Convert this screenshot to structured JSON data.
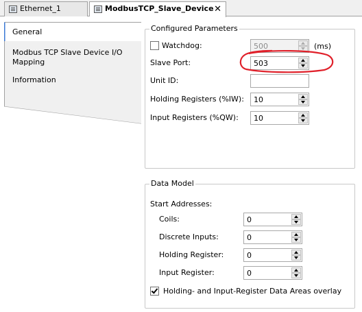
{
  "tabs": [
    {
      "label": "Ethernet_1",
      "icon": "device-icon",
      "active": false
    },
    {
      "label": "ModbusTCP_Slave_Device",
      "icon": "device-icon",
      "active": true,
      "close": "✕"
    }
  ],
  "nav": {
    "items": [
      {
        "label": "General",
        "selected": true
      },
      {
        "label": "Modbus TCP Slave Device I/O Mapping",
        "selected": false
      },
      {
        "label": "Information",
        "selected": false
      }
    ]
  },
  "configured": {
    "title": "Configured Parameters",
    "watchdog": {
      "label": "Watchdog:",
      "checked": false,
      "value": "500",
      "unit": "(ms)",
      "enabled": false
    },
    "slave_port": {
      "label": "Slave Port:",
      "value": "503",
      "highlight_color": "#e0202a"
    },
    "unit_id": {
      "label": "Unit ID:",
      "value": ""
    },
    "holding": {
      "label": "Holding Registers (%IW):",
      "value": "10"
    },
    "input": {
      "label": "Input Registers (%QW):",
      "value": "10"
    }
  },
  "data_model": {
    "title": "Data Model",
    "start_addresses": "Start Addresses:",
    "coils": {
      "label": "Coils:",
      "value": "0"
    },
    "discrete": {
      "label": "Discrete Inputs:",
      "value": "0"
    },
    "holding": {
      "label": "Holding Register:",
      "value": "0"
    },
    "input": {
      "label": "Input Register:",
      "value": "0"
    },
    "overlay": {
      "label": "Holding- and Input-Register Data Areas overlay",
      "checked": true
    }
  },
  "colors": {
    "selected_item_bg": "#ffffff",
    "nav_bg": "#f0f0f0",
    "border": "#a0a0a0"
  }
}
